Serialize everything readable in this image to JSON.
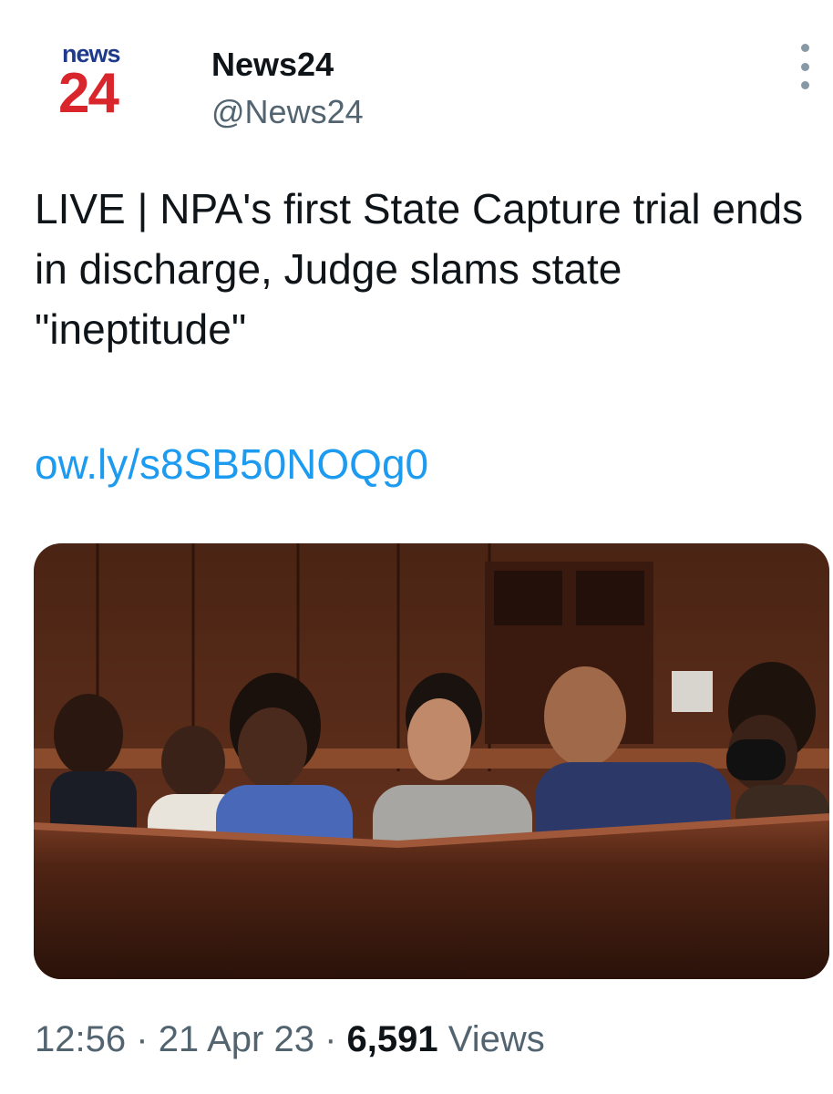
{
  "account": {
    "avatar_line1": "news",
    "avatar_line2": "24",
    "display_name": "News24",
    "handle": "@News24"
  },
  "tweet": {
    "text": "LIVE | NPA's first State Capture trial ends in discharge, Judge slams state \"ineptitude\"",
    "link": "ow.ly/s8SB50NOQg0"
  },
  "meta": {
    "time": "12:56",
    "separator": "·",
    "date": "21 Apr 23",
    "views_count": "6,591",
    "views_label": "Views"
  },
  "colors": {
    "brand_blue": "#1f3a8a",
    "brand_red": "#d9262d",
    "link": "#1d9bf0",
    "secondary_text": "#536471"
  },
  "icons": {
    "more": "more-vertical-icon"
  }
}
